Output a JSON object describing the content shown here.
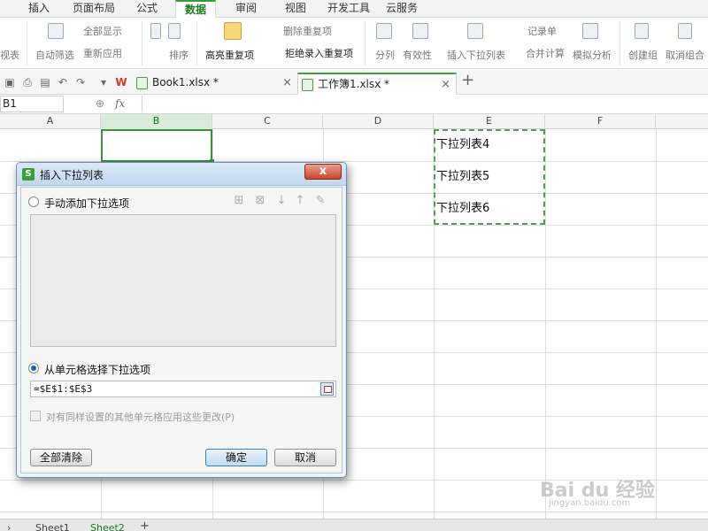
{
  "ribbon_tabs": [
    "插入",
    "页面布局",
    "公式",
    "数据",
    "审阅",
    "视图",
    "开发工具",
    "云服务"
  ],
  "ribbon_active_tab": "数据",
  "ribbon": {
    "view_table": "视表",
    "auto_filter": "自动筛选",
    "show_all": "全部显示",
    "reapply": "重新应用",
    "sort": "排序",
    "highlight_dup": "高亮重复项",
    "delete_dup": "删除重复项",
    "reject_dup": "拒绝录入重复项",
    "split_col": "分列",
    "validity": "有效性",
    "insert_dropdown": "插入下拉列表",
    "record_form": "记录单",
    "merge_calc": "合并计算",
    "simulate": "模拟分析",
    "create_group": "创建组",
    "ungroup": "取消组合"
  },
  "doc_tabs": [
    {
      "label": "Book1.xlsx *"
    },
    {
      "label": "工作簿1.xlsx *"
    }
  ],
  "new_tab_symbol": "+",
  "formula_bar": {
    "name_box": "B1",
    "fx": "fx"
  },
  "columns": [
    "A",
    "B",
    "C",
    "D",
    "E",
    "F"
  ],
  "selected_column": "B",
  "cells": {
    "E1": "下拉列表4",
    "E2": "下拉列表5",
    "E3": "下拉列表6"
  },
  "sheet_tabs": [
    "Sheet1",
    "Sheet2"
  ],
  "dialog": {
    "title": "插入下拉列表",
    "close": "x",
    "manual_option": "手动添加下拉选项",
    "from_cells_option": "从单元格选择下拉选项",
    "range_value": "=$E$1:$E$3",
    "apply_same": "对有同样设置的其他单元格应用这些更改(P)",
    "clear_all": "全部清除",
    "ok": "确定",
    "cancel": "取消"
  },
  "watermark": {
    "text": "Bai du 经验",
    "sub": "jingyan.baidu.com"
  },
  "colors": {
    "accent_green": "#3a9a3a",
    "dialog_frame": "#6c8bb5"
  }
}
